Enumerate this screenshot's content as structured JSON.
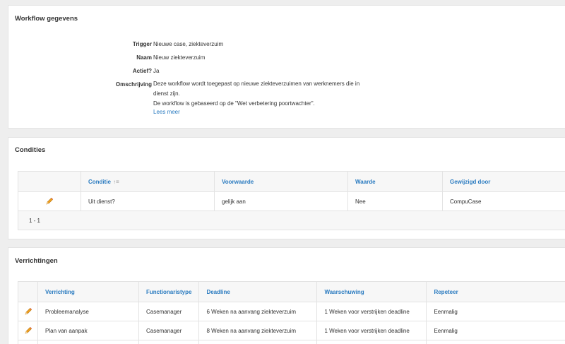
{
  "workflow": {
    "title": "Workflow gegevens",
    "fields": {
      "trigger_label": "Trigger",
      "trigger_value": "Nieuwe case, ziekteverzuim",
      "naam_label": "Naam",
      "naam_value": "Nieuw ziekteverzuim",
      "actief_label": "Actief?",
      "actief_value": "Ja",
      "omschrijving_label": "Omschrijving",
      "omschrijving_line1": "Deze workflow wordt toegepast op nieuwe ziekteverzuimen van werknemers die in",
      "omschrijving_line2": "dienst zijn.",
      "omschrijving_line3": "De workflow is gebaseerd op de \"Wet verbetering poortwachter\".",
      "lees_meer": "Lees meer"
    }
  },
  "condities": {
    "title": "Condities",
    "columns": [
      "Conditie",
      "Voorwaarde",
      "Waarde",
      "Gewijzigd door"
    ],
    "sort_icon": "sort-ascending-icon",
    "rows": [
      {
        "conditie": "Uit dienst?",
        "voorwaarde": "gelijk aan",
        "waarde": "Nee",
        "gewijzigd_door": "CompuCase"
      }
    ],
    "pagination": "1 - 1"
  },
  "verrichtingen": {
    "title": "Verrichtingen",
    "columns": [
      "Verrichting",
      "Functionaristype",
      "Deadline",
      "Waarschuwing",
      "Repeteer"
    ],
    "rows": [
      {
        "verrichting": "Probleemanalyse",
        "functionaristype": "Casemanager",
        "deadline": "6 Weken na aanvang ziekteverzuim",
        "waarschuwing": "1 Weken voor verstrijken deadline",
        "repeteer": "Eenmalig"
      },
      {
        "verrichting": "Plan van aanpak",
        "functionaristype": "Casemanager",
        "deadline": "8 Weken na aanvang ziekteverzuim",
        "waarschuwing": "1 Weken voor verstrijken deadline",
        "repeteer": "Eenmalig"
      }
    ]
  },
  "colors": {
    "link": "#2a7bc0",
    "header_bg": "#f7f7f7",
    "pencil": "#f0a020"
  }
}
